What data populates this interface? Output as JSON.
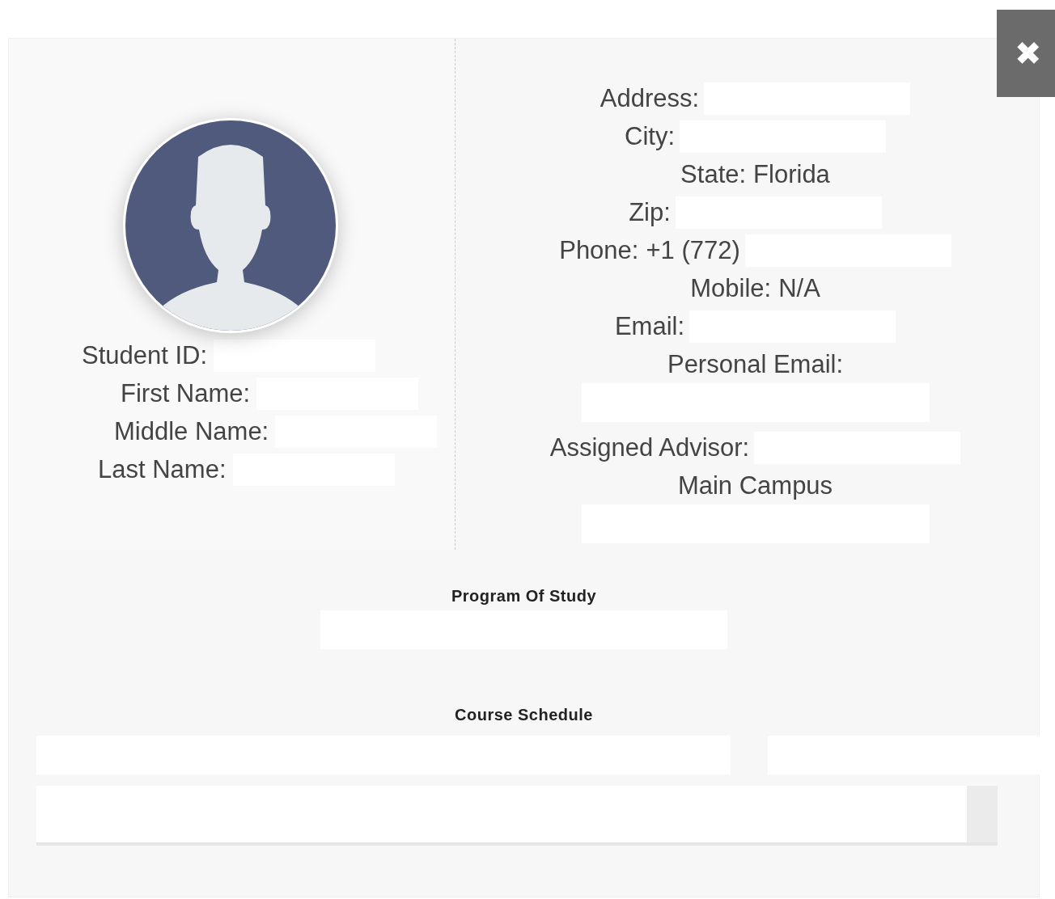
{
  "close_button": {
    "label": "✖"
  },
  "identity": [
    {
      "label": "Student ID:",
      "redacted": true
    },
    {
      "label": "First Name:",
      "redacted": true
    },
    {
      "label": "Middle Name:",
      "redacted": true
    },
    {
      "label": "Last Name:",
      "redacted": true
    }
  ],
  "contact": [
    {
      "label": "Address:",
      "kind": "inline",
      "redacted": true
    },
    {
      "label": "City:",
      "kind": "inline",
      "redacted": true
    },
    {
      "label": "State:",
      "value": "Florida"
    },
    {
      "label": "Zip:",
      "kind": "inline",
      "redacted": true
    },
    {
      "label": "Phone:",
      "value": "+1 (772)",
      "kind": "inline",
      "redacted": true
    },
    {
      "label": "Mobile:",
      "value": "N/A"
    },
    {
      "label": "Email:",
      "kind": "inline",
      "redacted": true
    },
    {
      "label": "Personal Email:",
      "kind": "below",
      "redacted": true
    },
    {
      "label": "Assigned Advisor:",
      "kind": "inline",
      "redacted": true
    },
    {
      "label": "Main Campus",
      "kind": "below",
      "redacted": true
    }
  ],
  "sections": [
    {
      "title": "Program Of Study",
      "kind": "single"
    },
    {
      "title": "Course Schedule",
      "kind": "schedule"
    }
  ]
}
